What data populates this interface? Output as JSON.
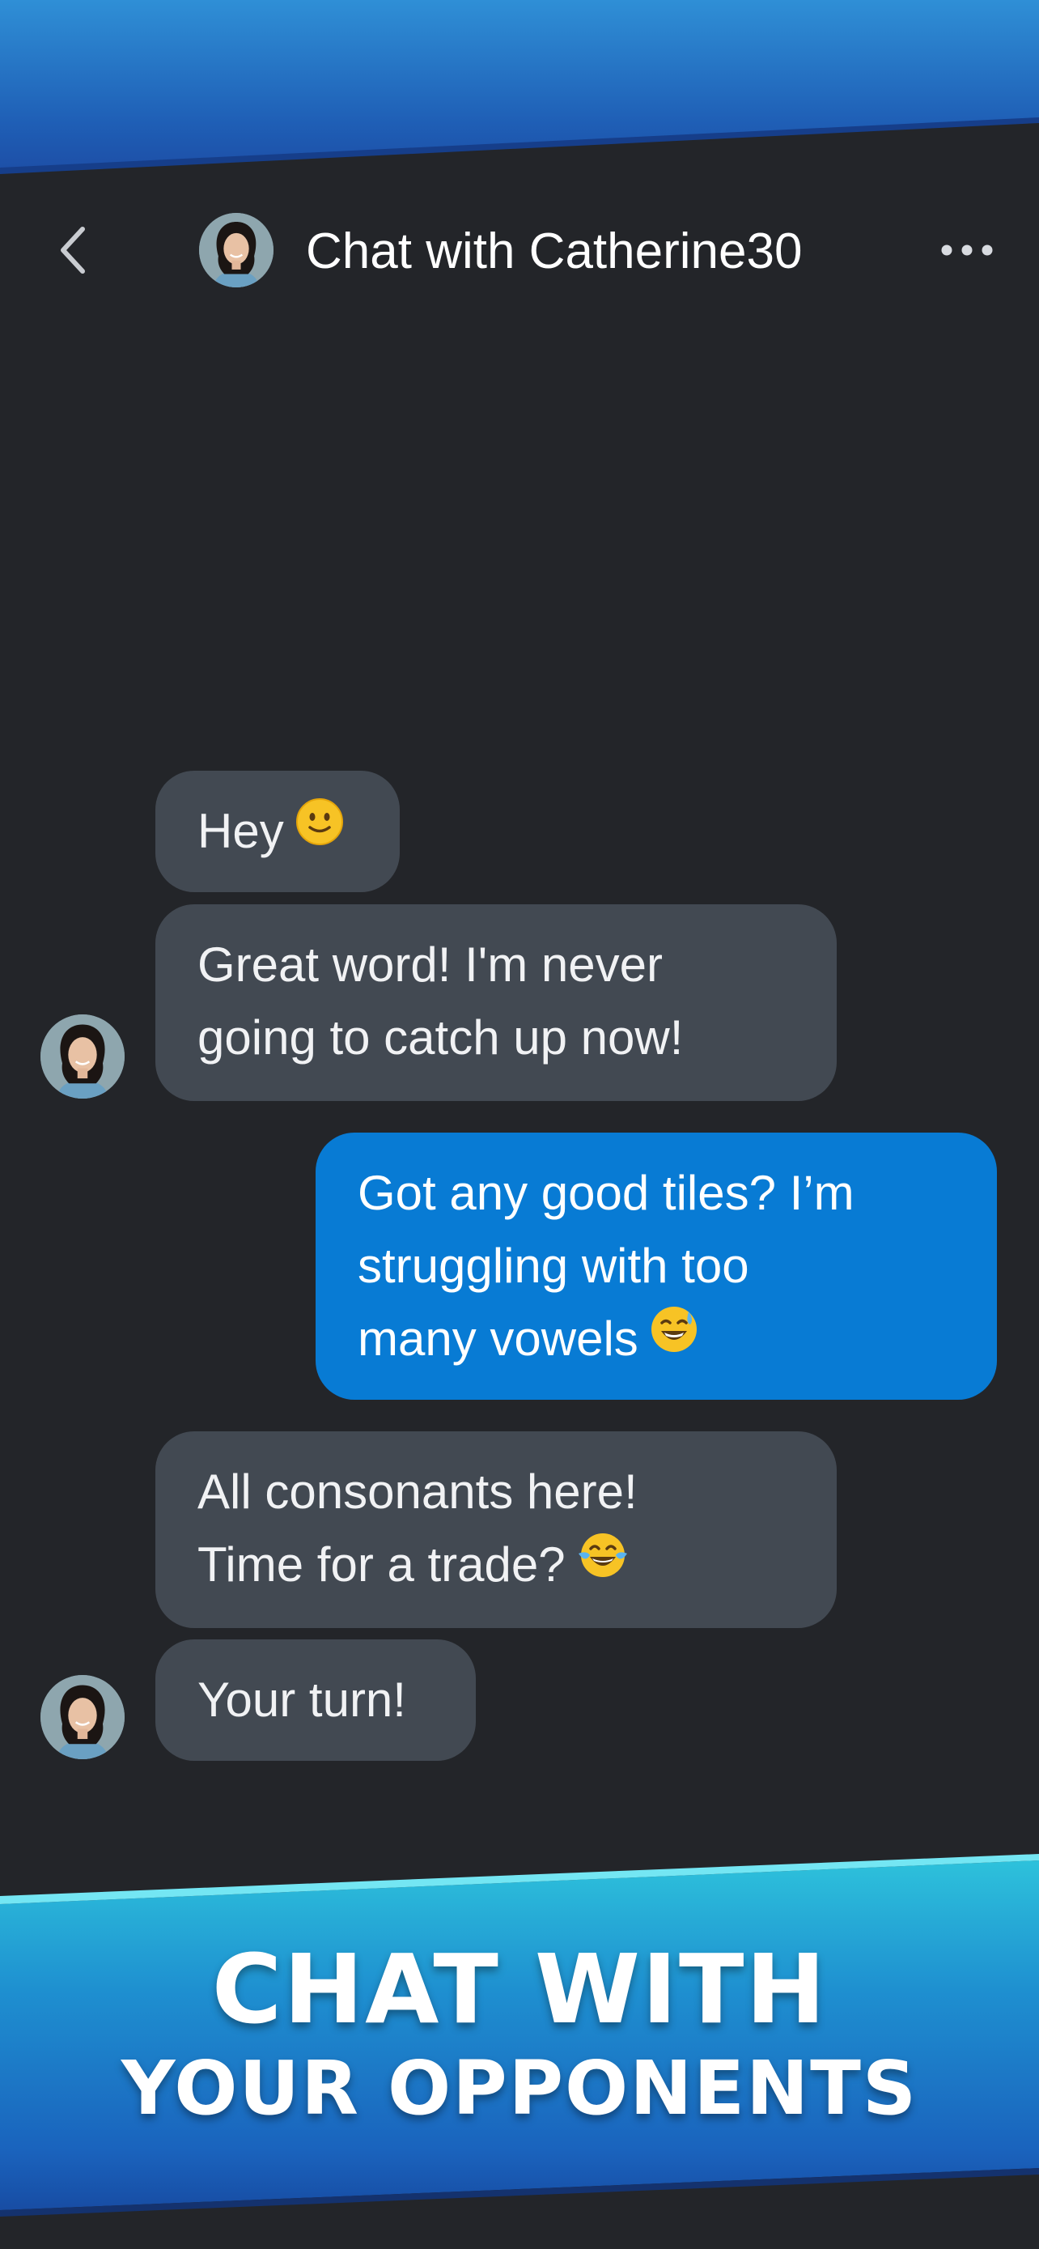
{
  "header": {
    "title": "Chat with Catherine30",
    "back_icon": "chevron-left-icon",
    "more_icon": "more-horizontal-icon"
  },
  "messages": [
    {
      "sender": "Catherine30",
      "direction": "incoming",
      "lines": [
        "Hey"
      ],
      "emoji": "slightly-smiling-face"
    },
    {
      "sender": "Catherine30",
      "direction": "incoming",
      "lines": [
        "Great word! I'm never",
        "going to catch up now!"
      ]
    },
    {
      "sender": "me",
      "direction": "outgoing",
      "lines": [
        "Got any good tiles? I’m",
        "struggling with too",
        "many vowels"
      ],
      "emoji": "grinning-face-with-sweat"
    },
    {
      "sender": "Catherine30",
      "direction": "incoming",
      "lines": [
        "All consonants here!",
        "Time for a trade?"
      ],
      "emoji": "face-with-tears-of-joy"
    },
    {
      "sender": "Catherine30",
      "direction": "incoming",
      "lines": [
        "Your turn!"
      ]
    }
  ],
  "promo": {
    "line1": "CHAT WITH",
    "line2": "YOUR OPPONENTS"
  },
  "colors": {
    "background": "#232529",
    "incoming_bubble": "#424952",
    "outgoing_bubble": "#087bd4",
    "banner_top": "#2f8fd6",
    "banner_bottom": "#1d4ea6"
  }
}
